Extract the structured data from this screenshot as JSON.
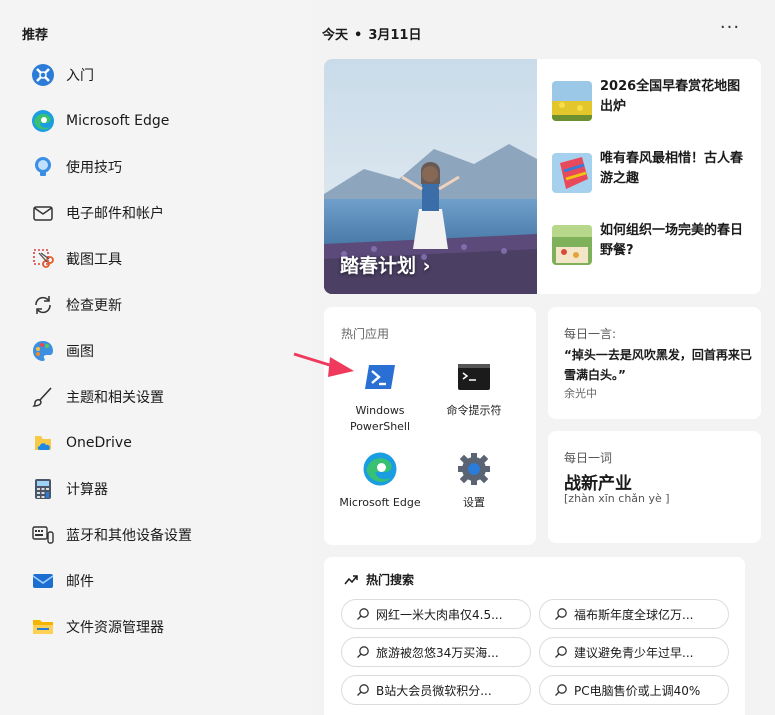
{
  "left": {
    "title": "推荐",
    "items": [
      {
        "label": "入门",
        "icon": "get-started-icon"
      },
      {
        "label": "Microsoft Edge",
        "icon": "edge-icon"
      },
      {
        "label": "使用技巧",
        "icon": "tips-icon"
      },
      {
        "label": "电子邮件和帐户",
        "icon": "mail-outline-icon"
      },
      {
        "label": "截图工具",
        "icon": "snipping-tool-icon"
      },
      {
        "label": "检查更新",
        "icon": "refresh-icon"
      },
      {
        "label": "画图",
        "icon": "paint-icon"
      },
      {
        "label": "主题和相关设置",
        "icon": "brush-icon"
      },
      {
        "label": "OneDrive",
        "icon": "onedrive-icon"
      },
      {
        "label": "计算器",
        "icon": "calculator-icon"
      },
      {
        "label": "蓝牙和其他设备设置",
        "icon": "keyboard-icon"
      },
      {
        "label": "邮件",
        "icon": "mail-app-icon"
      },
      {
        "label": "文件资源管理器",
        "icon": "folder-icon"
      }
    ]
  },
  "header": {
    "today": "今天",
    "date": "3月11日",
    "more": "···"
  },
  "news": {
    "hero_caption": "踏春计划 ›",
    "items": [
      {
        "title": "2026全国早春赏花地图出炉"
      },
      {
        "title": "唯有春风最相惜！古人春游之趣"
      },
      {
        "title": "如何组织一场完美的春日野餐?"
      }
    ]
  },
  "apps": {
    "title": "热门应用",
    "items": [
      {
        "label": "Windows PowerShell",
        "icon": "powershell-icon"
      },
      {
        "label": "命令提示符",
        "icon": "cmd-icon"
      },
      {
        "label": "Microsoft Edge",
        "icon": "edge-icon"
      },
      {
        "label": "设置",
        "icon": "settings-gear-icon"
      }
    ]
  },
  "quote": {
    "title": "每日一言:",
    "text": "“掉头一去是风吹黑发，回首再来已雪满白头。”",
    "author": "余光中"
  },
  "word": {
    "title": "每日一词",
    "word": "战新产业",
    "pinyin": "[zhàn xīn chǎn yè ]"
  },
  "hot": {
    "title": "热门搜索",
    "chips": [
      "网红一米大肉串仅4.5...",
      "福布斯年度全球亿万...",
      "旅游被忽悠34万买海...",
      "建议避免青少年过早...",
      "B站大会员微软积分...",
      "PC电脑售价或上调40%"
    ]
  },
  "colors": {
    "arrow": "#ef3a5d",
    "accent": "#0078d4"
  }
}
